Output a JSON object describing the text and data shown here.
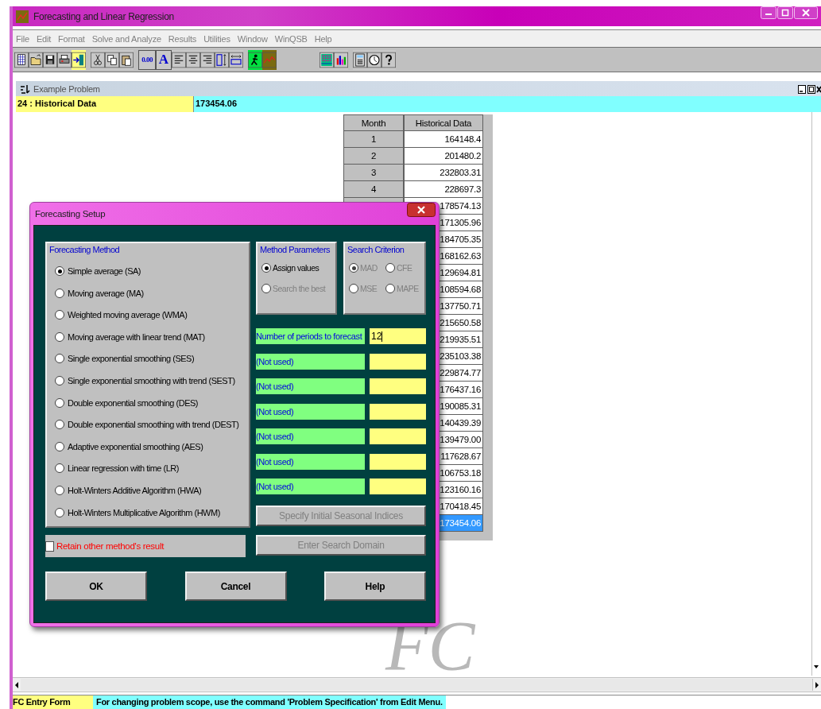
{
  "window": {
    "title": "Forecasting and Linear Regression"
  },
  "menu": [
    "File",
    "Edit",
    "Format",
    "Solve and Analyze",
    "Results",
    "Utilities",
    "Window",
    "WinQSB",
    "Help"
  ],
  "toolbar_labels": [
    "0.00",
    "A"
  ],
  "child_window": {
    "title": "Example Problem"
  },
  "cell_bar": {
    "reference": "24 : Historical Data",
    "value": "173454.06"
  },
  "table": {
    "columns": [
      "Month",
      "Historical Data"
    ],
    "rows": [
      {
        "month": "1",
        "value": "164148.4",
        "selected": false
      },
      {
        "month": "2",
        "value": "201480.2",
        "selected": false
      },
      {
        "month": "3",
        "value": "232803.31",
        "selected": false
      },
      {
        "month": "4",
        "value": "228697.3",
        "selected": false
      },
      {
        "value": "178574.13",
        "selected": false
      },
      {
        "value": "171305.96",
        "selected": false
      },
      {
        "value": "184705.35",
        "selected": false
      },
      {
        "value": "168162.63",
        "selected": false
      },
      {
        "value": "129694.81",
        "selected": false
      },
      {
        "value": "108594.68",
        "selected": false
      },
      {
        "value": "137750.71",
        "selected": false
      },
      {
        "value": "215650.58",
        "selected": false
      },
      {
        "value": "219935.51",
        "selected": false
      },
      {
        "value": "235103.38",
        "selected": false
      },
      {
        "value": "229874.77",
        "selected": false
      },
      {
        "value": "176437.16",
        "selected": false
      },
      {
        "value": "190085.31",
        "selected": false
      },
      {
        "value": "140439.39",
        "selected": false
      },
      {
        "value": "139479.00",
        "selected": false
      },
      {
        "value": "117628.67",
        "selected": false
      },
      {
        "value": "106753.18",
        "selected": false
      },
      {
        "value": "123160.16",
        "selected": false
      },
      {
        "value": "170418.45",
        "selected": false
      },
      {
        "value": "173454.06",
        "selected": true
      }
    ]
  },
  "logo": "FC",
  "dialog": {
    "title": "Forecasting Setup",
    "method_group": {
      "title": "Forecasting Method",
      "options": [
        {
          "label": "Simple average (SA)",
          "selected": true
        },
        {
          "label": "Moving average (MA)",
          "selected": false
        },
        {
          "label": "Weighted moving average (WMA)",
          "selected": false
        },
        {
          "label": "Moving average with linear trend (MAT)",
          "selected": false
        },
        {
          "label": "Single exponential smoothing (SES)",
          "selected": false
        },
        {
          "label": "Single exponential smoothing with trend (SEST)",
          "selected": false
        },
        {
          "label": "Double exponential smoothing (DES)",
          "selected": false
        },
        {
          "label": "Double exponential smoothing with trend (DEST)",
          "selected": false
        },
        {
          "label": "Adaptive exponential smoothing (AES)",
          "selected": false
        },
        {
          "label": "Linear regression with time (LR)",
          "selected": false
        },
        {
          "label": "Holt-Winters Additive Algorithm (HWA)",
          "selected": false
        },
        {
          "label": "Holt-Winters Multiplicative Algorithm (HWM)",
          "selected": false
        }
      ]
    },
    "parameter_group": {
      "title": "Method Parameters",
      "options": [
        {
          "label": "Assign values",
          "selected": true,
          "disabled": false
        },
        {
          "label": "Search the best",
          "selected": false,
          "disabled": true
        }
      ]
    },
    "criterion_group": {
      "title": "Search Criterion",
      "options": [
        {
          "label": "MAD",
          "selected": true,
          "disabled": true
        },
        {
          "label": "CFE",
          "selected": false,
          "disabled": true
        },
        {
          "label": "MSE",
          "selected": false,
          "disabled": true
        },
        {
          "label": "MAPE",
          "selected": false,
          "disabled": true
        }
      ]
    },
    "parameters": [
      {
        "label": "Number of periods to forecast",
        "value": "12"
      },
      {
        "label": "(Not used)"
      },
      {
        "label": "(Not used)"
      },
      {
        "label": "(Not used)"
      },
      {
        "label": "(Not used)"
      },
      {
        "label": "(Not used)"
      },
      {
        "label": "(Not used)"
      }
    ],
    "action_buttons": [
      {
        "label": "Specify Initial Seasonal Indices",
        "disabled": true
      },
      {
        "label": "Enter Search Domain",
        "disabled": true
      }
    ],
    "retain": {
      "label": "Retain other method's result",
      "checked": false
    },
    "buttons": [
      "OK",
      "Cancel",
      "Help"
    ]
  },
  "status_bar": {
    "form": "FC Entry Form",
    "message": "For changing problem scope, use the command 'Problem Specification' from Edit Menu."
  }
}
